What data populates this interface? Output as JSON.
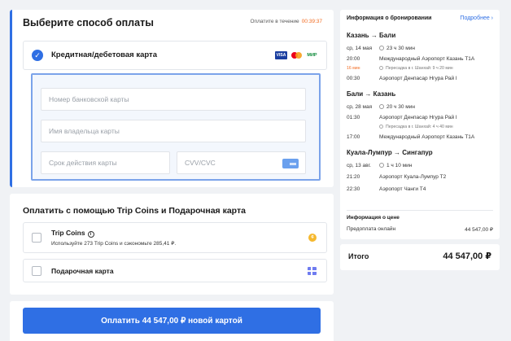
{
  "payment": {
    "title": "Выберите способ оплаты",
    "timer_label": "Оплатите в течение",
    "timer_value": "00:39:37",
    "card_option_label": "Кредитная/дебетовая карта",
    "logos": {
      "visa": "VISA",
      "mir": "МИР"
    },
    "fields": {
      "card_number": "Номер банковской карты",
      "holder_name": "Имя владельца карты",
      "expiry": "Срок действия карты",
      "cvv": "CVV/CVC"
    }
  },
  "coins": {
    "title": "Оплатить с помощью Trip Coins и Подарочная карта",
    "trip_coins_label": "Trip Coins",
    "trip_coins_sub": "Используйте 273 Trip Coins и сэкономьте 285,41 ₽.",
    "gift_card_label": "Подарочная карта"
  },
  "pay_button": "Оплатить 44 547,00 ₽ новой картой",
  "booking": {
    "title": "Информация о бронировании",
    "more": "Подробнее ›",
    "segments": [
      {
        "route": "Казань → Бали",
        "date": "ср, 14 мая",
        "duration": "23 ч 30 мин",
        "rows": [
          {
            "time": "20:00",
            "airport": "Международный Аэропорт Казань T1A"
          },
          {
            "time": "16 мин",
            "airport": "Пересадка в г. Шанхай: 9 ч 20 мин",
            "transfer": true
          },
          {
            "time": "00:30",
            "airport": "Аэропорт Денпасар Нгура Рай I"
          }
        ]
      },
      {
        "route": "Бали → Казань",
        "date": "ср, 28 мая",
        "duration": "20 ч 30 мин",
        "rows": [
          {
            "time": "01:30",
            "airport": "Аэропорт Денпасар Нгура Рай I"
          },
          {
            "time": "",
            "airport": "Пересадка в г. Шанхай: 4 ч 40 мин",
            "transfer": true
          },
          {
            "time": "17:00",
            "airport": "Международный Аэропорт Казань T1A"
          }
        ]
      },
      {
        "route": "Куала-Лумпур → Сингапур",
        "date": "ср, 13 авг.",
        "duration": "1 ч 10 мин",
        "rows": [
          {
            "time": "21:20",
            "airport": "Аэропорт Куала-Лумпур T2"
          },
          {
            "time": "22:30",
            "airport": "Аэропорт Чанги T4"
          }
        ]
      }
    ],
    "price_title": "Информация о цене",
    "prepay_label": "Предоплата онлайн",
    "prepay_value": "44 547,00 ₽"
  },
  "total": {
    "label": "Итого",
    "value": "44 547,00 ₽"
  },
  "colors": {
    "accent": "#2f6fe4",
    "timer": "#f26b21",
    "background": "#f0f2f5"
  }
}
